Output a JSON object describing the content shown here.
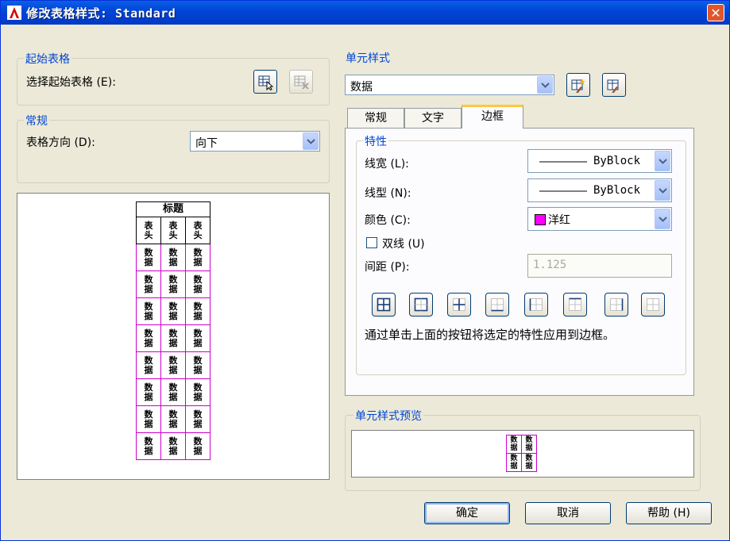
{
  "window": {
    "title": "修改表格样式: Standard",
    "close_symbol": "✕"
  },
  "start_table": {
    "group_title": "起始表格",
    "select_label": "选择起始表格 (E):"
  },
  "general": {
    "group_title": "常规",
    "direction_label": "表格方向 (D):",
    "direction_value": "向下"
  },
  "preview_table": {
    "title": "标题",
    "header_cell": "表头",
    "data_cell": "数据",
    "data_rows": 8,
    "columns": 3
  },
  "cell_style": {
    "group_title": "单元样式",
    "selected": "数据",
    "tabs": [
      "常规",
      "文字",
      "边框"
    ],
    "active_tab": "边框"
  },
  "properties": {
    "group_title": "特性",
    "lineweight_label": "线宽 (L):",
    "lineweight_value": "ByBlock",
    "linetype_label": "线型 (N):",
    "linetype_value": "ByBlock",
    "color_label": "颜色 (C):",
    "color_value": "洋红",
    "color_swatch": "#ff00ff",
    "double_line_label": "双线 (U)",
    "double_line_checked": false,
    "spacing_label": "间距 (P):",
    "spacing_value": "1.125",
    "hint": "通过单击上面的按钮将选定的特性应用到边框。"
  },
  "cell_preview": {
    "group_title": "单元样式预览",
    "cell_text": "数据"
  },
  "buttons": {
    "ok": "确定",
    "cancel": "取消",
    "help": "帮助 (H)"
  },
  "colors": {
    "title_bar": "#0146d8",
    "group_title": "#0046d5",
    "magenta": "#cc00cc"
  }
}
